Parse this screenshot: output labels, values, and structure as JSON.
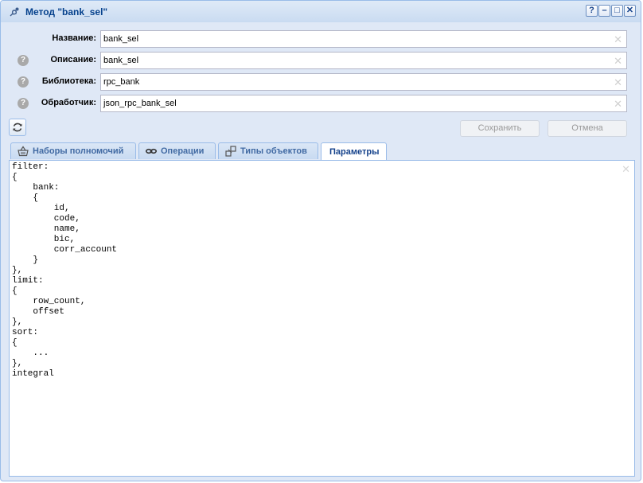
{
  "window": {
    "title": "Метод \"bank_sel\""
  },
  "tools": {
    "help": "?",
    "minimize": "–",
    "maximize": "□",
    "close": "✕"
  },
  "fields": [
    {
      "label": "Название:",
      "value": "bank_sel",
      "help": false
    },
    {
      "label": "Описание:",
      "value": "bank_sel",
      "help": true
    },
    {
      "label": "Библиотека:",
      "value": "rpc_bank",
      "help": true
    },
    {
      "label": "Обработчик:",
      "value": "json_rpc_bank_sel",
      "help": true
    }
  ],
  "help_glyph": "?",
  "clear_glyph": "✕",
  "buttons": {
    "save": "Сохранить",
    "cancel": "Отмена"
  },
  "tabs": [
    {
      "label": "Наборы полномочий",
      "icon": "basket-icon"
    },
    {
      "label": "Операции",
      "icon": "link-icon"
    },
    {
      "label": "Типы объектов",
      "icon": "object-types-icon"
    },
    {
      "label": "Параметры",
      "active": true
    }
  ],
  "parameters_text": "filter:\n{\n    bank:\n    {\n        id,\n        code,\n        name,\n        bic,\n        corr_account\n    }\n},\nlimit:\n{\n    row_count,\n    offset\n},\nsort:\n{\n    ...\n},\nintegral",
  "colors": {
    "title": "#04408c",
    "border": "#99bce8",
    "panel": "#dfe8f6",
    "tab_text": "#416aa3"
  }
}
